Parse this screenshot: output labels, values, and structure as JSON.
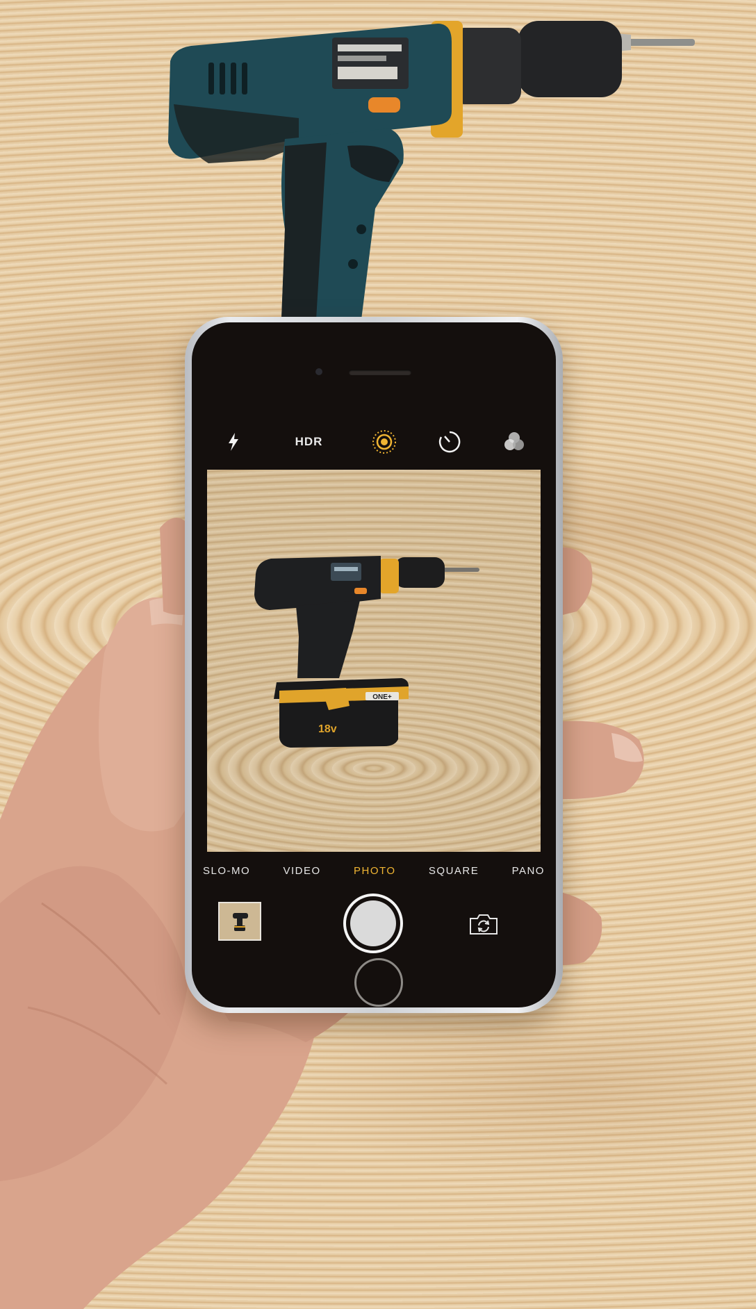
{
  "camera_app": {
    "top_bar": {
      "flash_icon": "lightning-bolt-icon",
      "hdr_label": "HDR",
      "live_photo_icon": "live-photo-icon",
      "timer_icon": "timer-icon",
      "filters_icon": "filters-icon"
    },
    "modes": [
      {
        "label": "SLO-MO",
        "active": false
      },
      {
        "label": "VIDEO",
        "active": false
      },
      {
        "label": "PHOTO",
        "active": true
      },
      {
        "label": "SQUARE",
        "active": false
      },
      {
        "label": "PANO",
        "active": false
      }
    ],
    "bottom_bar": {
      "thumbnail_icon": "last-photo-thumbnail",
      "shutter_icon": "shutter-button-icon",
      "flip_icon": "flip-camera-icon"
    },
    "accent_color": "#f0b533"
  },
  "viewfinder_subject": {
    "battery_brand": "ONE+",
    "battery_voltage": "18v"
  }
}
